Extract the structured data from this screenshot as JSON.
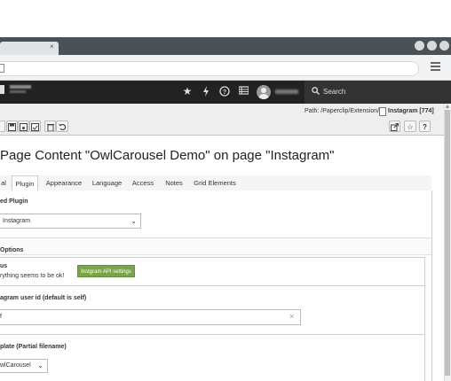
{
  "browser": {
    "tab_close": "×",
    "menu_icon": "hamburger-menu-icon"
  },
  "topbar": {
    "search_label": "Search",
    "icons": [
      "star-icon",
      "bolt-icon",
      "help-icon",
      "list-icon",
      "avatar-icon"
    ]
  },
  "docheader": {
    "path_label": "Path: /Paperclip/Extension/",
    "page_label": "Instagram [774]"
  },
  "title": "Page Content \"OwlCarousel Demo\" on page \"Instagram\"",
  "tabs": [
    {
      "label": "al"
    },
    {
      "label": "Plugin"
    },
    {
      "label": "Appearance"
    },
    {
      "label": "Language"
    },
    {
      "label": "Access"
    },
    {
      "label": "Notes"
    },
    {
      "label": "Grid Elements"
    }
  ],
  "form": {
    "selected_plugin_label": "ed Plugin",
    "selected_plugin_value": "Instagram",
    "section_options": "Options",
    "status_label": "us",
    "status_text": "rything seems to be ok!",
    "api_button": "Instgram API settings",
    "userid_label": "agram user id (default is self)",
    "userid_value": "f",
    "template_label": "plate (Partial filename)",
    "template_value": "wlCarousel"
  },
  "colors": {
    "topbar_bg": "#222222",
    "docheader_bg": "#eeeeee",
    "api_button_bg": "#79a548"
  }
}
